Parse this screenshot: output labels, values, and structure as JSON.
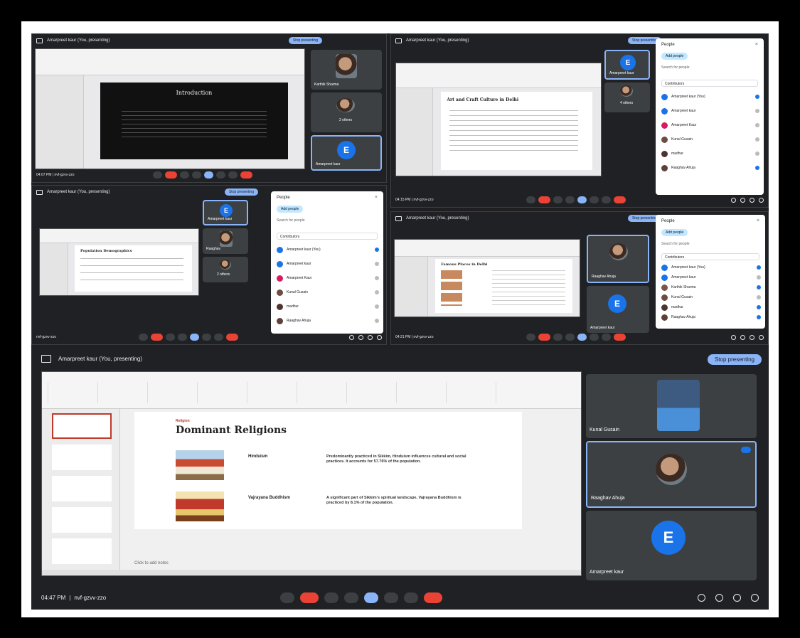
{
  "panel1": {
    "title": "Amarpreet kaur (You, presenting)",
    "stop": "Stop presenting",
    "slide_title": "Introduction",
    "tiles": [
      "Karthik Sharma",
      "2 others",
      "Amarpreet kaur"
    ],
    "time": "04:07 PM | nvf-gzvv-zzo"
  },
  "panel2": {
    "title": "Amarpreet kaur (You, presenting)",
    "stop": "Stop presenting",
    "slide_title": "Art and Craft Culture in Delhi",
    "tiles": [
      "Amarpreet kaur",
      "4 others"
    ],
    "time": "04:15 PM | nvf-gzvv-zzo",
    "people": {
      "title": "People",
      "add": "Add people",
      "search": "Search for people",
      "contrib": "Contributors",
      "rows": [
        "Amarpreet kaur (You)",
        "Amarpreet kaur",
        "Amarpreet Kaur",
        "Kunal Gusain",
        "madhur",
        "Raaghav Ahuja"
      ]
    }
  },
  "panel3": {
    "title": "Amarpreet kaur (You, presenting)",
    "stop": "Stop presenting",
    "slide_title": "Population Demographics",
    "tiles": [
      "Amarpreet kaur",
      "Raaghav",
      "2 others"
    ],
    "time": "nvf-gzvv-zzo",
    "people": {
      "title": "People",
      "add": "Add people",
      "search": "Search for people",
      "contrib": "Contributors",
      "rows": [
        "Amarpreet kaur (You)",
        "Amarpreet kaur",
        "Amarpreet Kaur",
        "Kunal Gusain",
        "madhur",
        "Raaghav Ahuja"
      ]
    }
  },
  "panel4": {
    "title": "Amarpreet kaur (You, presenting)",
    "stop": "Stop presenting",
    "slide_title": "Famous Places in Delhi",
    "tiles": [
      "Raaghav Ahuja",
      "Amarpreet kaur"
    ],
    "time": "04:21 PM | nvf-gzvv-zzo",
    "people": {
      "title": "People",
      "add": "Add people",
      "search": "Search for people",
      "contrib": "Contributors",
      "rows": [
        "Amarpreet kaur (You)",
        "Amarpreet kaur",
        "Karthik Sharma",
        "Kunal Gusain",
        "madhur",
        "Raaghav Ahuja"
      ]
    }
  },
  "main": {
    "title": "Amarpreet kaur (You, presenting)",
    "stop": "Stop presenting",
    "kicker": "Religion",
    "heading": "Dominant Religions",
    "rel1_name": "Hinduism",
    "rel1_desc": "Predominantly practiced in Sikkim, Hinduism influences cultural and social practices. It accounts for 57.76% of the population.",
    "rel2_name": "Vajrayana Buddhism",
    "rel2_desc": "A significant part of Sikkim's spiritual landscape, Vajrayana Buddhism is practiced by 8.1% of the population.",
    "notes": "Click to add notes",
    "tiles": [
      "Kunal Gusain",
      "Raaghav Ahuja",
      "Amarpreet kaur"
    ],
    "time": "04:47 PM",
    "code": "nvf-gzvv-zzo"
  },
  "avatar_letter": "E",
  "colors": {
    "accent": "#8ab4f8",
    "end_call": "#ea4335",
    "avatar": "#1a73e8",
    "bg": "#202124"
  }
}
